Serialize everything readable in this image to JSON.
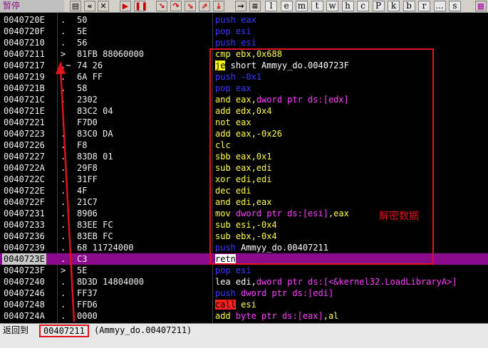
{
  "toolbar": {
    "pause_label": "暂停",
    "letters": [
      "l",
      "e",
      "m",
      "t",
      "w",
      "h",
      "c",
      "P",
      "k",
      "b",
      "r",
      "...",
      "s"
    ]
  },
  "rows": [
    {
      "addr": "0040720E",
      "mark": ".",
      "hex": "50",
      "asm": [
        {
          "t": "push eax",
          "c": "#3a3aff"
        }
      ]
    },
    {
      "addr": "0040720F",
      "mark": ".",
      "hex": "5E",
      "asm": [
        {
          "t": "pop esi",
          "c": "#3a3aff"
        }
      ]
    },
    {
      "addr": "00407210",
      "mark": ".",
      "hex": "56",
      "asm": [
        {
          "t": "push esi",
          "c": "#3a3aff"
        }
      ]
    },
    {
      "addr": "00407211",
      "mark": ">",
      "hex": "81FB 88060000",
      "asm": [
        {
          "t": "cmp ",
          "c": "#ffff40"
        },
        {
          "t": "ebx",
          "c": "#ffff40"
        },
        {
          "t": ",0x688",
          "c": "#ffff40"
        }
      ]
    },
    {
      "addr": "00407217",
      "mark": ".~",
      "hex": "74 26",
      "asm": [
        {
          "t": "je",
          "c": "#000",
          "bg": "#ffff00"
        },
        {
          "t": " short Ammyy_do.0040723F",
          "c": "#ffffff"
        }
      ]
    },
    {
      "addr": "00407219",
      "mark": ".",
      "hex": "6A FF",
      "asm": [
        {
          "t": "push -0x1",
          "c": "#3a3aff"
        }
      ]
    },
    {
      "addr": "0040721B",
      "mark": ".",
      "hex": "58",
      "asm": [
        {
          "t": "pop eax",
          "c": "#3a3aff"
        }
      ]
    },
    {
      "addr": "0040721C",
      "mark": ".",
      "hex": "2302",
      "asm": [
        {
          "t": "and ",
          "c": "#ffff40"
        },
        {
          "t": "eax,",
          "c": "#ffff40"
        },
        {
          "t": "dword ptr ds:[edx]",
          "c": "#ff40ff"
        }
      ]
    },
    {
      "addr": "0040721E",
      "mark": ".",
      "hex": "83C2 04",
      "asm": [
        {
          "t": "add edx,0x4",
          "c": "#ffff40"
        }
      ]
    },
    {
      "addr": "00407221",
      "mark": ".",
      "hex": "F7D0",
      "asm": [
        {
          "t": "not eax",
          "c": "#ffff40"
        }
      ]
    },
    {
      "addr": "00407223",
      "mark": ".",
      "hex": "83C0 DA",
      "asm": [
        {
          "t": "add eax,-0x26",
          "c": "#ffff40"
        }
      ]
    },
    {
      "addr": "00407226",
      "mark": ".",
      "hex": "F8",
      "asm": [
        {
          "t": "clc",
          "c": "#ffff40"
        }
      ]
    },
    {
      "addr": "00407227",
      "mark": ".",
      "hex": "83D8 01",
      "asm": [
        {
          "t": "sbb eax,0x1",
          "c": "#ffff40"
        }
      ]
    },
    {
      "addr": "0040722A",
      "mark": ".",
      "hex": "29F8",
      "asm": [
        {
          "t": "sub eax,edi",
          "c": "#ffff40"
        }
      ]
    },
    {
      "addr": "0040722C",
      "mark": ".",
      "hex": "31FF",
      "asm": [
        {
          "t": "xor edi,edi",
          "c": "#ffff40"
        }
      ]
    },
    {
      "addr": "0040722E",
      "mark": ".",
      "hex": "4F",
      "asm": [
        {
          "t": "dec edi",
          "c": "#ffff40"
        }
      ]
    },
    {
      "addr": "0040722F",
      "mark": ".",
      "hex": "21C7",
      "asm": [
        {
          "t": "and edi,eax",
          "c": "#ffff40"
        }
      ]
    },
    {
      "addr": "00407231",
      "mark": ".",
      "hex": "8906",
      "asm": [
        {
          "t": "mov ",
          "c": "#ffff40"
        },
        {
          "t": "dword ptr ds:[esi]",
          "c": "#ff40ff"
        },
        {
          "t": ",eax",
          "c": "#ffff40"
        }
      ]
    },
    {
      "addr": "00407233",
      "mark": ".",
      "hex": "83EE FC",
      "asm": [
        {
          "t": "sub esi,-0x4",
          "c": "#ffff40"
        }
      ]
    },
    {
      "addr": "00407236",
      "mark": ".",
      "hex": "83EB FC",
      "asm": [
        {
          "t": "sub ebx,-0x4",
          "c": "#ffff40"
        }
      ]
    },
    {
      "addr": "00407239",
      "mark": ".",
      "hex": "68 11724000",
      "asm": [
        {
          "t": "push",
          "c": "#3a3aff"
        },
        {
          "t": " Ammyy_do.00407211",
          "c": "#ffffff"
        }
      ]
    },
    {
      "addr": "0040723E",
      "mark": ".",
      "hex": "C3",
      "sel": true,
      "asm": [
        {
          "t": "retn",
          "c": "#000",
          "bg": "#ffffff"
        }
      ]
    },
    {
      "addr": "0040723F",
      "mark": ">",
      "hex": "5E",
      "asm": [
        {
          "t": "pop esi",
          "c": "#3a3aff"
        }
      ]
    },
    {
      "addr": "00407240",
      "mark": ".",
      "hex": "8D3D 14804000",
      "asm": [
        {
          "t": "lea edi,",
          "c": "#ffffff"
        },
        {
          "t": "dword ptr ds:[<&kernel32.LoadLibraryA>]",
          "c": "#ff40ff"
        }
      ]
    },
    {
      "addr": "00407246",
      "mark": ".",
      "hex": "FF37",
      "asm": [
        {
          "t": "push ",
          "c": "#3a3aff"
        },
        {
          "t": "dword ptr ds:[edi]",
          "c": "#ff40ff"
        }
      ]
    },
    {
      "addr": "00407248",
      "mark": ".",
      "hex": "FFD6",
      "asm": [
        {
          "t": "call",
          "c": "#000",
          "bg": "#ff2020"
        },
        {
          "t": " esi",
          "c": "#ffff40"
        }
      ]
    },
    {
      "addr": "0040724A",
      "mark": ".",
      "hex": "0000",
      "asm": [
        {
          "t": "add ",
          "c": "#ffff40"
        },
        {
          "t": "byte ptr ds:[eax]",
          "c": "#ff40ff"
        },
        {
          "t": ",al",
          "c": "#ffff40"
        }
      ]
    }
  ],
  "annotation": {
    "label": "解密数据"
  },
  "status": {
    "prefix": "返回到",
    "addr": "00407211",
    "detail": "(Ammyy_do.00407211)"
  },
  "colors": {
    "accent_red": "#e0121a",
    "selection": "#8c0a8c"
  }
}
